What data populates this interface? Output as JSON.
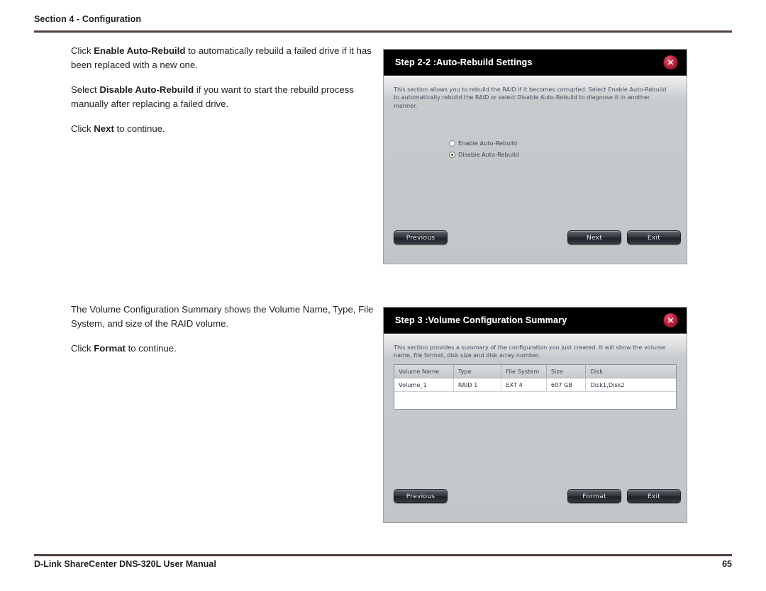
{
  "page": {
    "section_header": "Section 4 - Configuration",
    "footer_title": "D-Link ShareCenter DNS-320L User Manual",
    "page_number": "65",
    "rule_color": "#50413c"
  },
  "prose": {
    "block1": {
      "p1_pre": "Click ",
      "p1_bold": "Enable Auto-Rebuild",
      "p1_post": " to automatically rebuild a failed drive if it has been replaced with a new one.",
      "p2_pre": "Select ",
      "p2_bold": "Disable Auto-Rebuild",
      "p2_post": " if you want to start the rebuild process manually after replacing a failed drive.",
      "p3_pre": "Click ",
      "p3_bold": "Next",
      "p3_post": " to continue."
    },
    "block2": {
      "p1": "The Volume Configuration Summary shows the Volume Name, Type, File System, and size of the RAID volume.",
      "p2_pre": "Click ",
      "p2_bold": "Format",
      "p2_post": " to continue."
    }
  },
  "dialog_auto_rebuild": {
    "title": "Step 2-2 :Auto-Rebuild Settings",
    "close_icon": "close-x-icon",
    "description": "This section allows you to rebuild the RAID if it becomes corrupted. Select Enable Auto-Rebuild to automatically rebuild the RAID or select Disable Auto-Rebuild to diagnose it in another manner.",
    "radios": [
      {
        "label": "Enable Auto-Rebuild",
        "checked": false
      },
      {
        "label": "Disable Auto-Rebuild",
        "checked": true
      }
    ],
    "buttons": {
      "previous": "Previous",
      "middle": "Next",
      "exit": "Exit"
    }
  },
  "dialog_volume_summary": {
    "title": "Step 3 :Volume Configuration Summary",
    "close_icon": "close-x-icon",
    "description": "This section provides a summary of the configuration you just created. It will show the volume name, file format, disk size and disk array number.",
    "table": {
      "columns": [
        "Volume Name",
        "Type",
        "File System",
        "Size",
        "Disk"
      ],
      "rows": [
        [
          "Volume_1",
          "RAID 1",
          "EXT 4",
          "607 GB",
          "Disk1,Disk2"
        ]
      ]
    },
    "buttons": {
      "previous": "Previous",
      "middle": "Format",
      "exit": "Exit"
    }
  }
}
